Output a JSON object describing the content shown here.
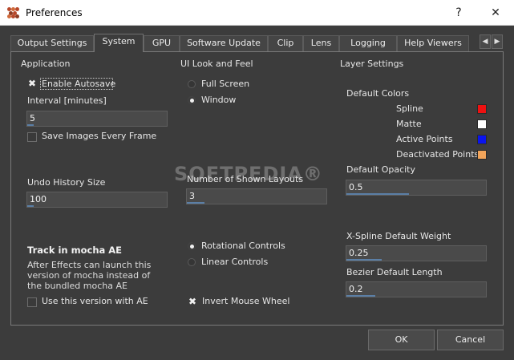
{
  "window": {
    "title": "Preferences",
    "help_glyph": "?",
    "close_glyph": "✕"
  },
  "tabs": [
    {
      "label": "Output Settings"
    },
    {
      "label": "System"
    },
    {
      "label": "GPU"
    },
    {
      "label": "Software Update"
    },
    {
      "label": "Clip"
    },
    {
      "label": "Lens"
    },
    {
      "label": "Logging"
    },
    {
      "label": "Help Viewers"
    }
  ],
  "tab_scroll": {
    "left": "◀",
    "right": "▶"
  },
  "application": {
    "title": "Application",
    "enable_autosave": "Enable Autosave",
    "interval_label": "Interval [minutes]",
    "interval_value": "5",
    "save_images": "Save Images Every Frame",
    "undo_label": "Undo History Size",
    "undo_value": "100"
  },
  "mocha": {
    "title": "Track in mocha AE",
    "description": "After Effects can launch this version of mocha instead of the bundled mocha AE",
    "use_version": "Use this version with AE"
  },
  "ui_look": {
    "title": "UI Look and Feel",
    "full_screen": "Full Screen",
    "window": "Window",
    "layouts_label": "Number of Shown Layouts",
    "layouts_value": "3",
    "rotational": "Rotational Controls",
    "linear": "Linear Controls",
    "invert_wheel": "Invert Mouse Wheel"
  },
  "layer": {
    "title": "Layer Settings",
    "default_colors": "Default Colors",
    "colors": [
      {
        "label": "Spline",
        "hex": "#ee1111"
      },
      {
        "label": "Matte",
        "hex": "#ffffff"
      },
      {
        "label": "Active Points",
        "hex": "#0a14ee"
      },
      {
        "label": "Deactivated Points",
        "hex": "#f2a45a"
      }
    ],
    "opacity_label": "Default Opacity",
    "opacity_value": "0.5",
    "xspline_label": "X-Spline Default Weight",
    "xspline_value": "0.25",
    "bezier_label": "Bezier Default Length",
    "bezier_value": "0.2"
  },
  "watermark": "SOFTPEDIA®",
  "buttons": {
    "ok": "OK",
    "cancel": "Cancel"
  }
}
